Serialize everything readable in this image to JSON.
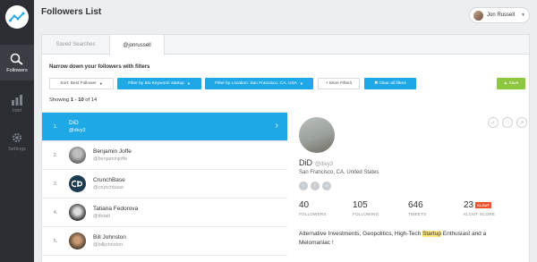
{
  "app": {
    "title": "Followers List"
  },
  "sidebar": {
    "items": [
      {
        "label": "Followers",
        "icon": "search-people-icon",
        "active": true
      },
      {
        "label": "Intel",
        "icon": "bar-chart-icon",
        "active": false
      },
      {
        "label": "Settings",
        "icon": "gear-icon",
        "active": false
      }
    ]
  },
  "user": {
    "name": "Jon Russell"
  },
  "tabs": [
    {
      "label": "Saved Searches",
      "active": false
    },
    {
      "label": "@jonrussell",
      "active": true
    }
  ],
  "filters": {
    "heading": "Narrow down your followers with filters",
    "sort_label": "Sort: Best Follower",
    "bio_label": "Filter by Bio Keyword: startup",
    "location_label": "Filter by Location: San Francisco, CA, USA",
    "more_label": "+ More Filters",
    "clear_label": "✖ Clear all filters",
    "save_label": "▲ Save"
  },
  "results": {
    "prefix": "Showing ",
    "range": "1 - 10",
    "suffix": " of 14"
  },
  "followers": [
    {
      "num": "1.",
      "name": "DiD",
      "handle": "@divy3",
      "active": true
    },
    {
      "num": "2.",
      "name": "Benjamin Joffe",
      "handle": "@benjaminjoffe",
      "active": false
    },
    {
      "num": "3.",
      "name": "CrunchBase",
      "handle": "@crunchbase",
      "active": false
    },
    {
      "num": "4.",
      "name": "Tatiana Fedorova",
      "handle": "@tfetati",
      "active": false
    },
    {
      "num": "5.",
      "name": "Bill Johnston",
      "handle": "@billjohnston",
      "active": false
    }
  ],
  "profile": {
    "name": "DiD",
    "handle": "@divy3",
    "location": "San Francisco, CA, United States",
    "stats": [
      {
        "value": "40",
        "label": "FOLLOWERS"
      },
      {
        "value": "105",
        "label": "FOLLOWING"
      },
      {
        "value": "646",
        "label": "TWEETS"
      },
      {
        "value": "23",
        "label": "KLOUT SCORE"
      }
    ],
    "klout_badge": "KLOUT",
    "bio_before": "Alternative Investments, Geopolitics, High-Tech ",
    "bio_highlight": "Startup",
    "bio_after": " Enthusiast and a Melomaniac !"
  },
  "colors": {
    "accent": "#1fa8e6",
    "save": "#8dc63f",
    "sidebar": "#2b2e33"
  }
}
